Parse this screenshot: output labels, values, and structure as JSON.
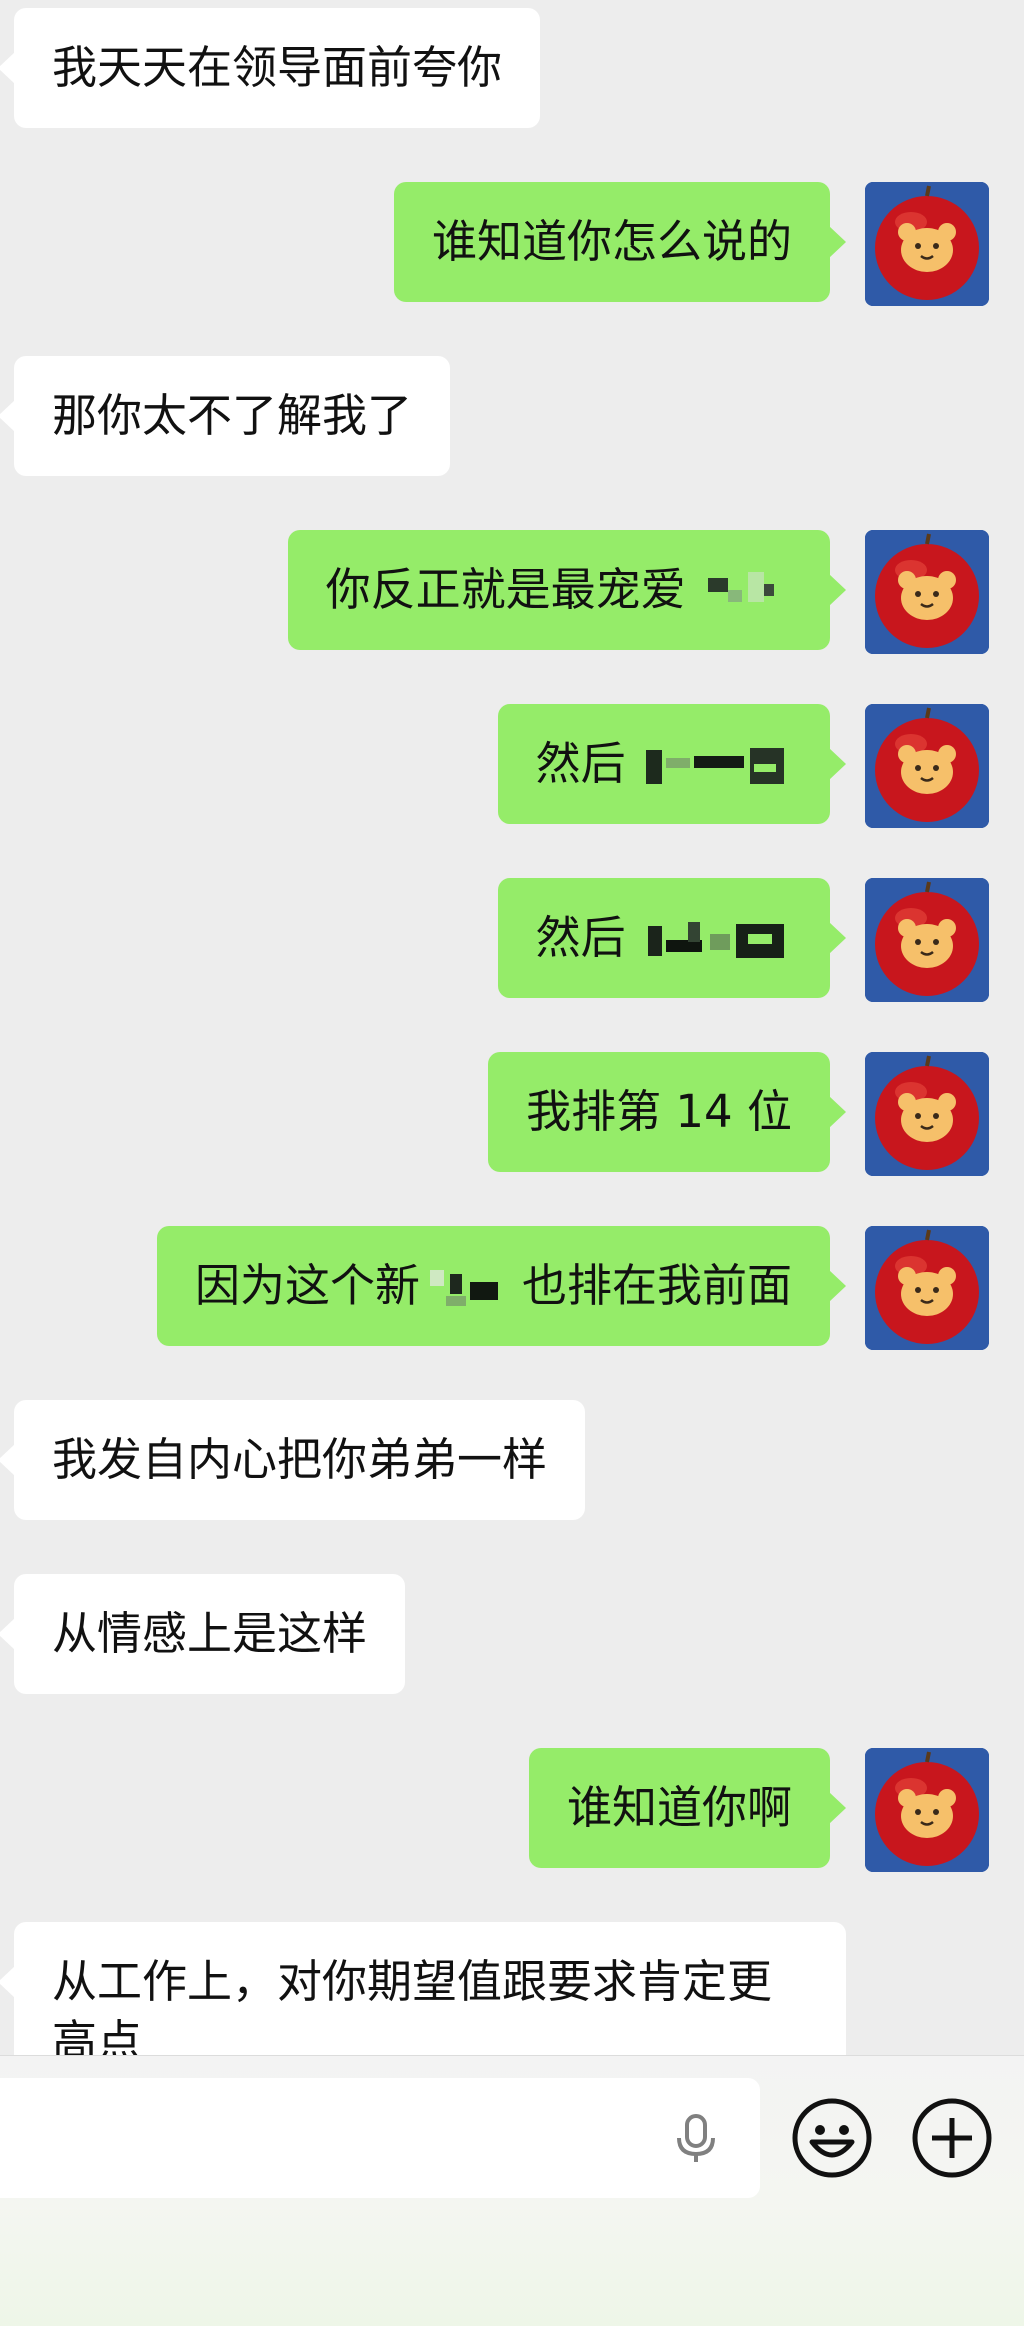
{
  "messages": [
    {
      "side": "in",
      "text": "我天天在领导面前夸你"
    },
    {
      "side": "out",
      "text": "谁知道你怎么说的"
    },
    {
      "side": "in",
      "text": "那你太不了解我了"
    },
    {
      "side": "out",
      "text": "你反正就是最宠爱"
    },
    {
      "side": "out",
      "text": "然后"
    },
    {
      "side": "out",
      "text": "然后"
    },
    {
      "side": "out",
      "text": "我排第 14 位"
    },
    {
      "side": "out",
      "text_before": "因为这个新",
      "text_after": "也排在我前面"
    },
    {
      "side": "in",
      "text": "我发自内心把你弟弟一样"
    },
    {
      "side": "in",
      "text": "从情感上是这样"
    },
    {
      "side": "out",
      "text": "谁知道你啊"
    },
    {
      "side": "in",
      "text": "从工作上，对你期望值跟要求肯定更高点"
    }
  ],
  "avatar_icon": "apple-bear-avatar",
  "input_bar": {
    "input_value": "",
    "voice_icon": "microphone-icon",
    "emoji_icon": "smiley-face-icon",
    "more_icon": "plus-circle-icon"
  },
  "colors": {
    "background": "#ededed",
    "incoming_bubble": "#ffffff",
    "outgoing_bubble": "#95ec69",
    "avatar_bg": "#2f5aa8",
    "apple_red": "#c8161d"
  }
}
